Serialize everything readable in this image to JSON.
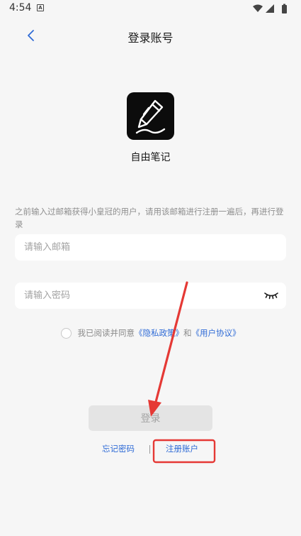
{
  "status_bar": {
    "time": "4:54",
    "app_badge": "A"
  },
  "header": {
    "title": "登录账号"
  },
  "app": {
    "name": "自由笔记"
  },
  "notice": {
    "text": "之前输入过邮箱获得小皇冠的用户，请用该邮箱进行注册一遍后，再进行登录"
  },
  "form": {
    "email_placeholder": "请输入邮箱",
    "email_value": "",
    "password_placeholder": "请输入密码",
    "password_value": ""
  },
  "agreement": {
    "checked": false,
    "prefix": "我已阅读并同意",
    "privacy_link": "《隐私政策》",
    "conjunction": "和",
    "terms_link": "《用户协议》"
  },
  "actions": {
    "login_label": "登录",
    "forgot_label": "忘记密码",
    "register_label": "注册账户"
  },
  "colors": {
    "accent": "#2f6bd6",
    "annotation": "#e53935",
    "background": "#f6f6f6"
  },
  "icons": {
    "back": "chevron-left-icon",
    "logo": "pencil-icon",
    "eye": "eye-closed-icon",
    "wifi": "wifi-icon",
    "signal": "signal-icon",
    "battery": "battery-icon"
  }
}
